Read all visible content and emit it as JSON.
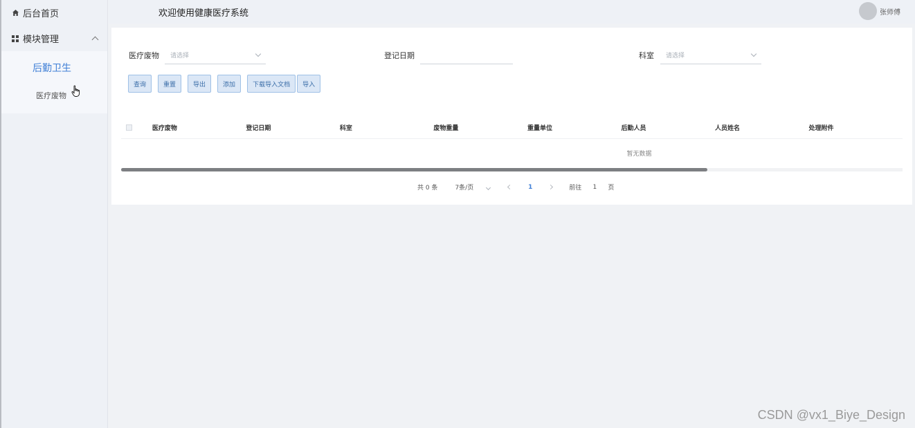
{
  "sidebar": {
    "home_label": "后台首页",
    "module_label": "模块管理",
    "submenu_title": "后勤卫生",
    "submenu_item": "医疗废物"
  },
  "topbar": {
    "welcome": "欢迎使用健康医疗系统",
    "user_name": "张师傅"
  },
  "filters": {
    "waste_label": "医疗废物",
    "waste_placeholder": "请选择",
    "date_label": "登记日期",
    "date_value": "",
    "dept_label": "科室",
    "dept_placeholder": "请选择"
  },
  "buttons": {
    "query": "查询",
    "reset": "重置",
    "export": "导出",
    "add": "添加",
    "download_template": "下载导入文档",
    "import": "导入"
  },
  "table": {
    "columns": [
      "医疗废物",
      "登记日期",
      "科室",
      "废物重量",
      "重量单位",
      "后勤人员",
      "人员姓名",
      "处理附件"
    ],
    "empty_text": "暂无数据",
    "scroll_fraction": 0.75
  },
  "pagination": {
    "total": "共 0 条",
    "page_size": "7条/页",
    "current_page": "1",
    "goto_label": "前往",
    "goto_value": "1",
    "page_suffix": "页"
  },
  "watermark": "CSDN @vx1_Biye_Design",
  "colors": {
    "accent": "#3f7fd6",
    "sidebar_bg": "#eef1f6",
    "button_bg": "#dbe7f6"
  },
  "icons": {
    "home": "home-icon",
    "module": "grid-icon",
    "expand": "chevron-up-icon",
    "cursor": "hand-pointer-icon"
  }
}
